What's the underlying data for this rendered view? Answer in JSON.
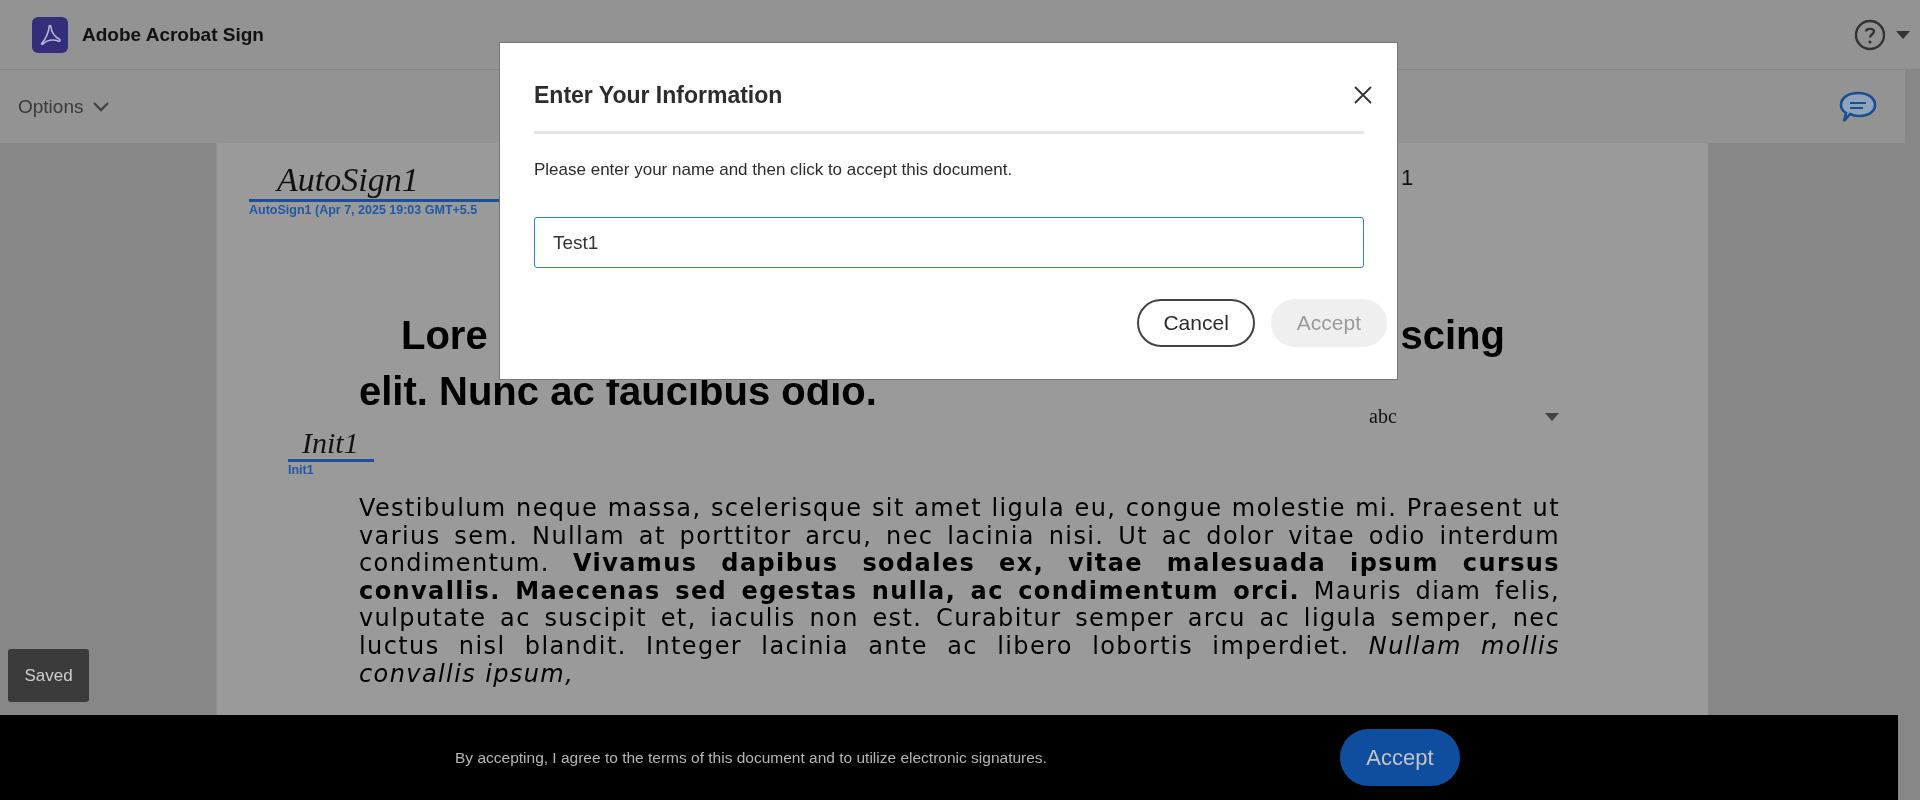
{
  "header": {
    "title": "Adobe Acrobat Sign"
  },
  "toolbar": {
    "options_label": "Options"
  },
  "document": {
    "signature": {
      "name": "AutoSign1",
      "caption": "AutoSign1 (Apr 7, 2025 19:03 GMT+5.5"
    },
    "partial_text": "1",
    "heading_parts": [
      "Lore",
      "scing"
    ],
    "heading_line_2": "elit. Nunc ac faucibus odio.",
    "dropdown": {
      "value": "abc"
    },
    "initials": {
      "name": "Init1",
      "caption": "Init1"
    },
    "paragraph": "Vestibulum neque massa, scelerisque sit amet ligula eu, congue molestie mi. Praesent ut varius sem. Nullam at porttitor arcu, nec lacinia nisi. Ut ac dolor vitae odio interdum condimentum. **Vivamus dapibus sodales ex, vitae malesuada ipsum cursus convallis. Maecenas sed egestas nulla, ac condimentum orci.** Mauris diam felis, vulputate ac suscipit et, iaculis non est. Curabitur semper arcu ac ligula semper, nec luctus nisl blandit. Integer lacinia ante ac libero lobortis imperdiet. *Nullam mollis convallis ipsum,*"
  },
  "saved_toast": "Saved",
  "dialog": {
    "title": "Enter Your Information",
    "message": "Please enter your name and then click to accept this document.",
    "name_field": {
      "value": "Test1"
    },
    "buttons": [
      {
        "label": "Cancel",
        "kind": "secondary",
        "disabled": false
      },
      {
        "label": "Accept",
        "kind": "primary",
        "disabled": true
      }
    ]
  },
  "accept_bar": {
    "message": "By accepting, I agree to the terms of this document and to utilize electronic signatures.",
    "button": "Accept"
  }
}
